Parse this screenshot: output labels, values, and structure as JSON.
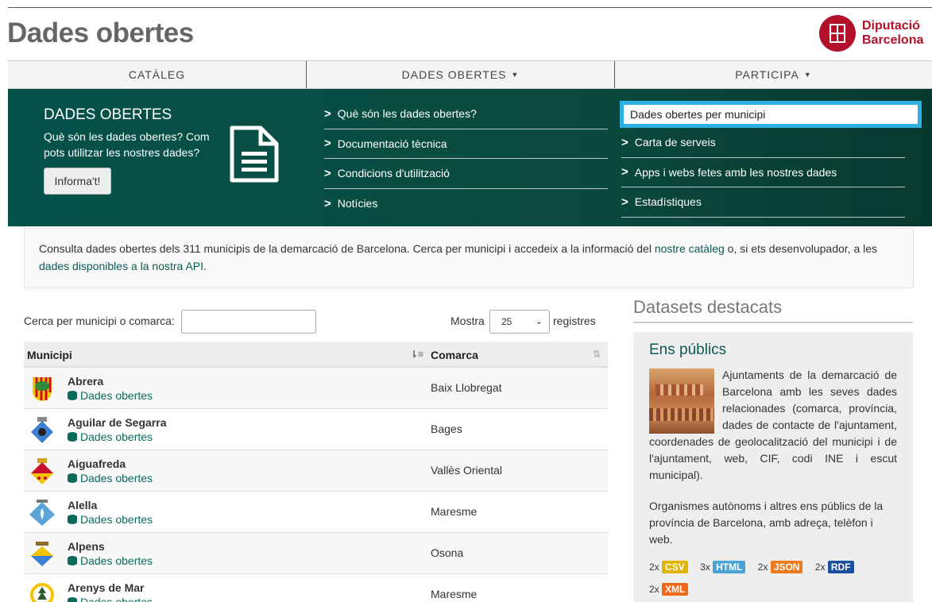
{
  "header": {
    "site_title": "Dades obertes",
    "logo_line1": "Diputació",
    "logo_line2": "Barcelona"
  },
  "nav": {
    "items": [
      {
        "label": "CATÀLEG",
        "has_caret": false
      },
      {
        "label": "DADES OBERTES",
        "has_caret": true
      },
      {
        "label": "PARTICIPA",
        "has_caret": true
      }
    ]
  },
  "mega": {
    "title": "DADES OBERTES",
    "description": "Què són les dades obertes? Com pots utilitzar les nostres dades?",
    "button": "Informa't!",
    "col1": [
      "Què són les dades obertes?",
      "Documentació tècnica",
      "Condicions d'utilització",
      "Notícies"
    ],
    "col2": [
      "Dades obertes per municipi",
      "Carta de serveis",
      "Apps i webs fetes amb les nostres dades",
      "Estadístiques"
    ],
    "highlight_color": "#2ab0e4"
  },
  "info": {
    "text1": "Consulta dades obertes dels 311 municipis de la demarcació de Barcelona. Cerca per municipi i accedeix a la informació del ",
    "link1": "nostre catàleg",
    "text2": " o, si ets desenvolupador, a les ",
    "link2": "dades disponibles a la nostra API",
    "text3": "."
  },
  "controls": {
    "search_label": "Cerca per municipi o comarca:",
    "search_value": "",
    "show_label": "Mostra",
    "show_value": "25",
    "registres_label": "registres"
  },
  "table": {
    "col_municipi": "Municipi",
    "col_comarca": "Comarca",
    "link_label": "Dades obertes",
    "rows": [
      {
        "name": "Abrera",
        "comarca": "Baix Llobregat"
      },
      {
        "name": "Aguilar de Segarra",
        "comarca": "Bages"
      },
      {
        "name": "Aiguafreda",
        "comarca": "Vallès Oriental"
      },
      {
        "name": "Alella",
        "comarca": "Maresme"
      },
      {
        "name": "Alpens",
        "comarca": "Osona"
      },
      {
        "name": "Arenys de Mar",
        "comarca": "Maresme"
      }
    ]
  },
  "side": {
    "title": "Datasets destacats",
    "dataset_title": "Ens públics",
    "p1": "Ajuntaments de la demarcació de Barcelona amb les seves dades relacionades (comarca, província, dades de contacte de l'ajuntament, coordenades de geolocalització del municipi i de l'ajuntament, web, CIF, codi INE i escut municipal).",
    "p2": "Organismes autònoms i altres ens públics de la província de Barcelona, amb adreça, telèfon i web.",
    "formats": [
      {
        "count": "2x",
        "label": "CSV",
        "color": "#e0b400"
      },
      {
        "count": "3x",
        "label": "HTML",
        "color": "#4aa3d8"
      },
      {
        "count": "2x",
        "label": "JSON",
        "color": "#ef7b1c"
      },
      {
        "count": "2x",
        "label": "RDF",
        "color": "#1d4f9c"
      },
      {
        "count": "2x",
        "label": "XML",
        "color": "#ef6a17"
      }
    ]
  }
}
